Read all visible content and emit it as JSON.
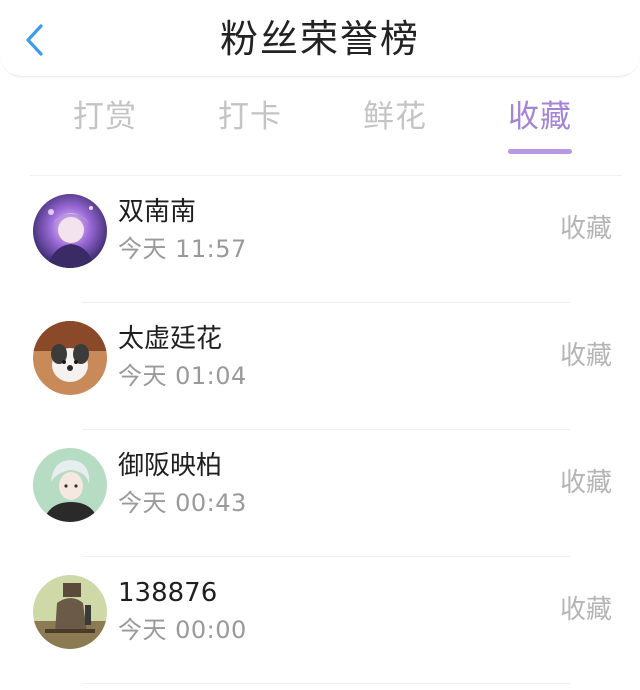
{
  "header": {
    "title": "粉丝荣誉榜",
    "back_icon": "chevron-left-icon",
    "accent_color": "#3d9be9"
  },
  "tabs": [
    {
      "label": "打赏",
      "active": false
    },
    {
      "label": "打卡",
      "active": false
    },
    {
      "label": "鲜花",
      "active": false
    },
    {
      "label": "收藏",
      "active": true
    }
  ],
  "active_tab_color": "#a584d6",
  "fans": [
    {
      "name": "双南南",
      "time": "今天 11:57",
      "action": "收藏"
    },
    {
      "name": "太虚廷花",
      "time": "今天 01:04",
      "action": "收藏"
    },
    {
      "name": "御阪映柏",
      "time": "今天 00:43",
      "action": "收藏"
    },
    {
      "name": "138876",
      "time": "今天 00:00",
      "action": "收藏"
    }
  ]
}
